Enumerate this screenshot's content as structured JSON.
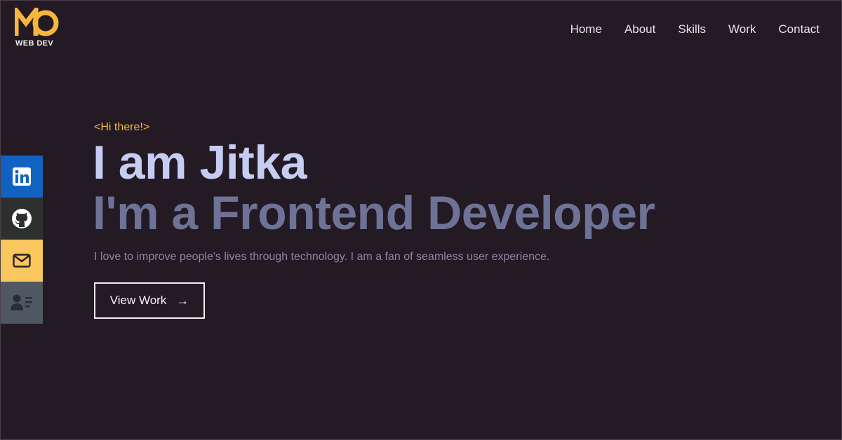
{
  "logo": {
    "text": "WEB DEV",
    "accent_color": "#f7b73a"
  },
  "nav": {
    "items": [
      "Home",
      "About",
      "Skills",
      "Work",
      "Contact"
    ]
  },
  "social": {
    "items": [
      {
        "icon": "linkedin-icon",
        "color": "#1262c1"
      },
      {
        "icon": "github-icon",
        "color": "#2e302f"
      },
      {
        "icon": "mail-icon",
        "color": "#f9c75d"
      },
      {
        "icon": "resume-icon",
        "color": "#4f5862"
      }
    ]
  },
  "hero": {
    "greeting": "<Hi there!>",
    "headline": "I am Jitka",
    "subheadline": "I'm a Frontend Developer",
    "tagline": "I love to improve people's lives through technology. I am a fan of seamless user experience.",
    "cta_label": "View Work",
    "cta_arrow": "→"
  },
  "colors": {
    "background": "#231a23",
    "greeting": "#f2b74a",
    "headline": "#c6cdf3",
    "subheadline": "#6d7296"
  }
}
